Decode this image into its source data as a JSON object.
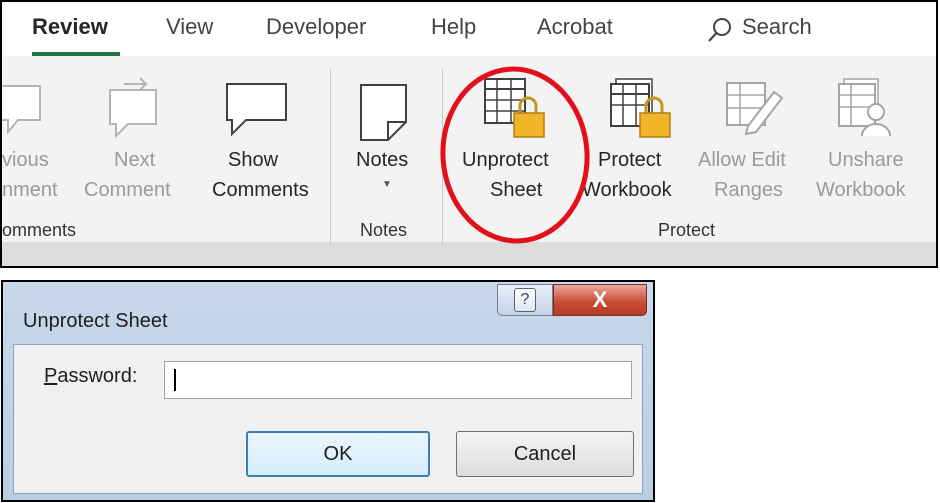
{
  "ribbon": {
    "tabs": [
      {
        "label": "Review",
        "active": true
      },
      {
        "label": "View"
      },
      {
        "label": "Developer"
      },
      {
        "label": "Help"
      },
      {
        "label": "Acrobat"
      }
    ],
    "search_label": "Search",
    "comments_group": {
      "previous_label_1": "vious",
      "previous_label_2": "nment",
      "next_label_1": "Next",
      "next_label_2": "Comment",
      "show_label_1": "Show",
      "show_label_2": "Comments",
      "group_label": "omments"
    },
    "notes_group": {
      "notes_label": "Notes",
      "dropdown_glyph": "▼",
      "group_label": "Notes"
    },
    "protect_group": {
      "unprotect_label_1": "Unprotect",
      "unprotect_label_2": "Sheet",
      "protect_label_1": "Protect",
      "protect_label_2": "Workbook",
      "allow_edit_label_1": "Allow Edit",
      "allow_edit_label_2": "Ranges",
      "unshare_label_1": "Unshare",
      "unshare_label_2": "Workbook",
      "group_label": "Protect"
    }
  },
  "dialog": {
    "title": "Unprotect Sheet",
    "help_glyph": "?",
    "close_glyph": "X",
    "password_label_accel": "P",
    "password_label_rest": "assword:",
    "password_value": "",
    "ok_label": "OK",
    "cancel_label": "Cancel"
  },
  "colors": {
    "accent_tab_underline": "#217346",
    "lock_gold": "#f0b429",
    "highlight_red": "#e3101b",
    "close_red": "#c84e36"
  }
}
